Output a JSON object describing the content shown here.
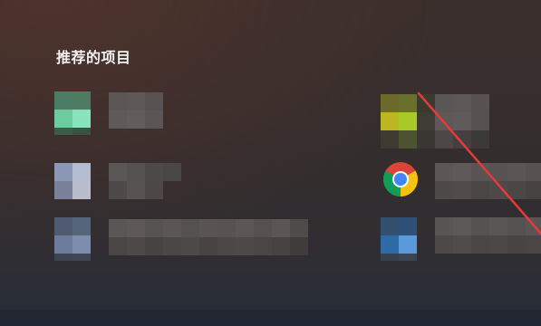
{
  "start_menu": {
    "section_title": "推荐的项目"
  },
  "colors": {
    "accent_red": "#e63a3a",
    "taskbar": "#212833"
  },
  "items": [
    {
      "name": "recommended-item-1",
      "icon": "blurred-app-icon-green"
    },
    {
      "name": "recommended-item-2",
      "icon": "blurred-app-icon-olive"
    },
    {
      "name": "recommended-item-3",
      "icon": "blurred-app-icon-gray-blue"
    },
    {
      "name": "recommended-item-4",
      "icon": "chrome-icon"
    },
    {
      "name": "recommended-item-5",
      "icon": "blurred-app-icon-slate"
    },
    {
      "name": "recommended-item-6",
      "icon": "blurred-app-icon-blue"
    }
  ]
}
